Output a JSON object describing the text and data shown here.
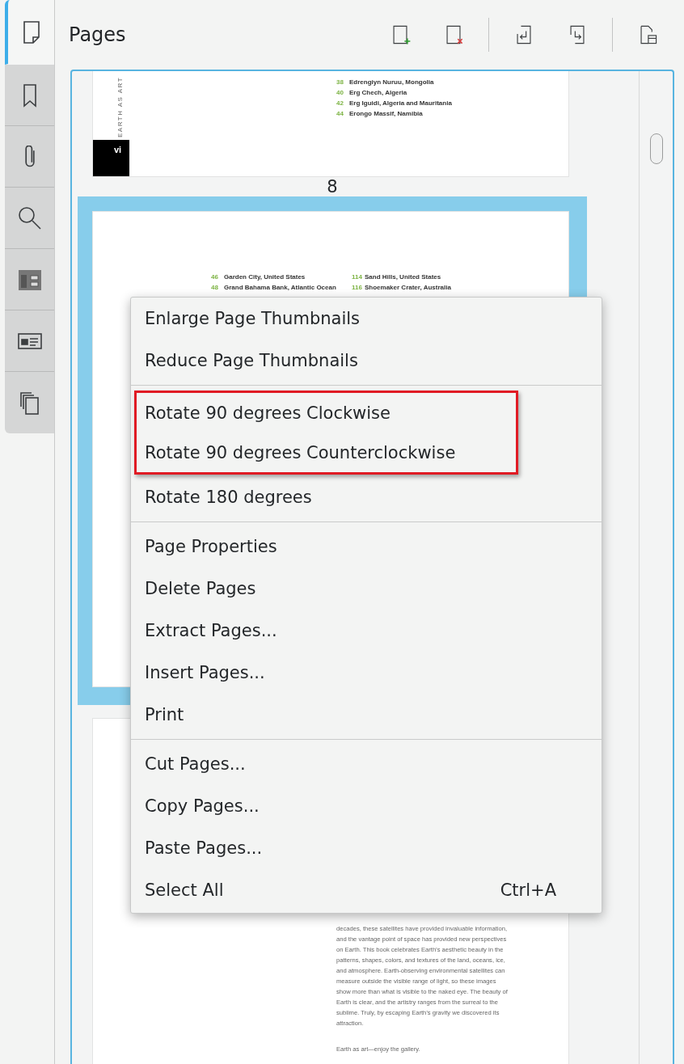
{
  "sidebar": {
    "tabs": [
      {
        "kind": "pages",
        "selected": true
      },
      {
        "kind": "bookmarks",
        "selected": false
      },
      {
        "kind": "attachments",
        "selected": false
      },
      {
        "kind": "search",
        "selected": false
      },
      {
        "kind": "structure",
        "selected": false
      },
      {
        "kind": "signatures",
        "selected": false
      },
      {
        "kind": "layers",
        "selected": false
      }
    ]
  },
  "panel": {
    "title": "Pages"
  },
  "toolbar": [
    {
      "kind": "insert"
    },
    {
      "kind": "delete"
    },
    {
      "kind": "separator"
    },
    {
      "kind": "extract"
    },
    {
      "kind": "replace"
    },
    {
      "kind": "separator"
    },
    {
      "kind": "properties"
    }
  ],
  "thumbnails": [
    {
      "kind": "contents-side",
      "selected": false,
      "page_number": "8",
      "side_text": "EARTH AS ART",
      "folio": "vi",
      "columns": [
        [
          {
            "num": "38",
            "name": "Edrengiyn Nuruu, Mongolia"
          },
          {
            "num": "40",
            "name": "Erg Chech, Algeria"
          },
          {
            "num": "42",
            "name": "Erg Iguidi, Algeria and Mauritania"
          },
          {
            "num": "44",
            "name": "Erongo Massif, Namibia"
          }
        ]
      ]
    },
    {
      "kind": "contents",
      "selected": true,
      "columns": [
        [
          {
            "num": "46",
            "name": "Garden City, United States"
          },
          {
            "num": "48",
            "name": "Grand Bahama Bank, Atlantic Ocean"
          }
        ],
        [
          {
            "num": "114",
            "name": "Sand Hills, United States"
          },
          {
            "num": "116",
            "name": "Shoemaker Crater, Australia"
          }
        ]
      ]
    },
    {
      "kind": "text",
      "selected": false,
      "paragraphs": [
        "decades, these satellites have provided invaluable information, and the vantage point of space has provided new perspectives on Earth. This book celebrates Earth’s aesthetic beauty in the patterns, shapes, colors, and textures of the land, oceans, ice, and atmosphere. Earth-observing environmental satellites can measure outside the visible range of light, so these images show more than what is visible to the naked eye. The beauty of Earth is clear, and the artistry ranges from the surreal to the sublime. Truly, by escaping Earth’s gravity we discovered its attraction.",
        "Earth as art—enjoy the gallery."
      ]
    }
  ],
  "context_menu": {
    "sections": [
      [
        {
          "label": "Enlarge Page Thumbnails",
          "highlighted": false
        },
        {
          "label": "Reduce Page Thumbnails",
          "highlighted": false
        }
      ],
      [
        {
          "label": "Rotate 90 degrees Clockwise",
          "highlighted": true
        },
        {
          "label": "Rotate 90 degrees Counterclockwise",
          "highlighted": true
        },
        {
          "label": "Rotate 180 degrees",
          "highlighted": false
        }
      ],
      [
        {
          "label": "Page Properties",
          "highlighted": false
        },
        {
          "label": "Delete Pages",
          "highlighted": false
        },
        {
          "label": "Extract Pages...",
          "highlighted": false
        },
        {
          "label": "Insert Pages...",
          "highlighted": false
        },
        {
          "label": "Print",
          "highlighted": false
        }
      ],
      [
        {
          "label": "Cut Pages...",
          "highlighted": false
        },
        {
          "label": "Copy Pages...",
          "highlighted": false
        },
        {
          "label": "Paste Pages...",
          "highlighted": false
        },
        {
          "label": "Select All",
          "shortcut": "Ctrl+A",
          "highlighted": false
        }
      ]
    ]
  }
}
